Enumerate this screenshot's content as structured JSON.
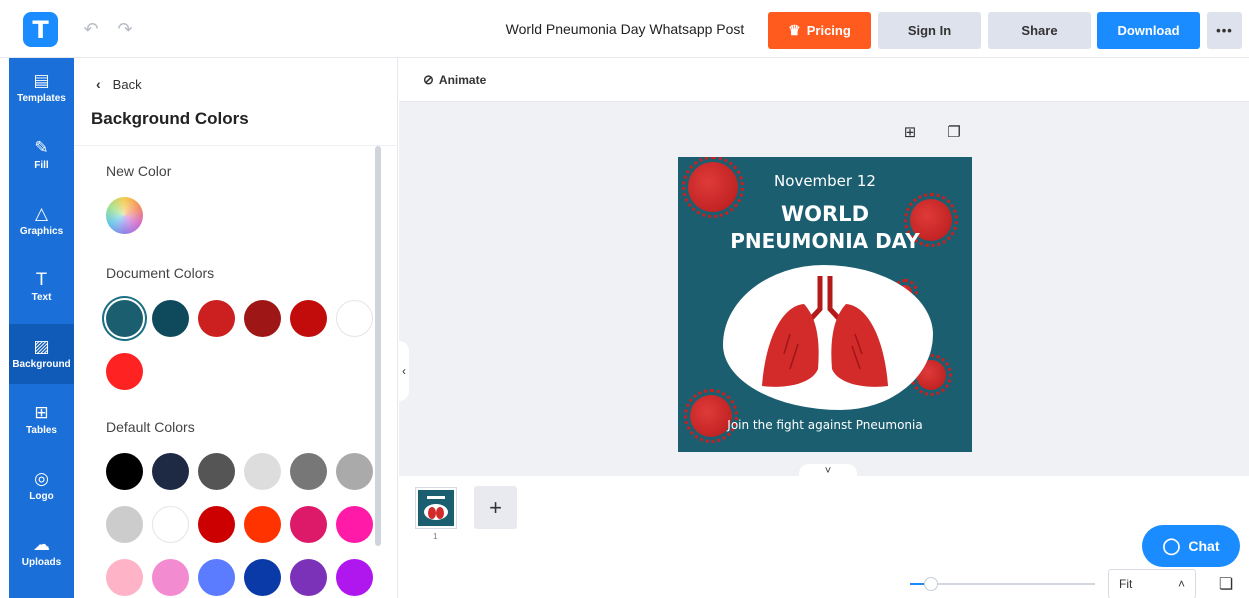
{
  "header": {
    "logo_letter": "T",
    "doc_title": "World Pneumonia Day Whatsapp Post",
    "pricing_label": "Pricing",
    "signin_label": "Sign In",
    "share_label": "Share",
    "download_label": "Download",
    "more_label": "•••"
  },
  "rail": {
    "items": [
      {
        "label": "Templates",
        "icon": "templates-icon"
      },
      {
        "label": "Fill",
        "icon": "pencil-icon"
      },
      {
        "label": "Graphics",
        "icon": "shapes-icon"
      },
      {
        "label": "Text",
        "icon": "text-icon"
      },
      {
        "label": "Background",
        "icon": "background-icon"
      },
      {
        "label": "Tables",
        "icon": "table-icon"
      },
      {
        "label": "Logo",
        "icon": "logo-icon"
      },
      {
        "label": "Uploads",
        "icon": "upload-cloud-icon"
      }
    ],
    "active": "Background"
  },
  "panel": {
    "back_label": "Back",
    "title": "Background Colors",
    "new_color_label": "New Color",
    "document_colors_label": "Document Colors",
    "default_colors_label": "Default Colors",
    "document_colors": [
      "#1b5e70",
      "#0f4a5c",
      "#cc1f1f",
      "#9e1616",
      "#c20c0c",
      "#ffffff",
      "#ff2222"
    ],
    "default_colors": [
      "#000000",
      "#1e2a44",
      "#555555",
      "#dddddd",
      "#777777",
      "#aaaaaa",
      "#cccccc",
      "#ffffff",
      "#cc0000",
      "#ff3300",
      "#dd1a6a",
      "#ff1aa8",
      "#ffb3c6",
      "#f38bd0",
      "#5b7cff",
      "#0a3aa8",
      "#7b32b8",
      "#b016ee"
    ],
    "selected_document_color": "#1b5e70"
  },
  "canvas": {
    "animate_label": "Animate",
    "design": {
      "date_text": "November 12",
      "title_line1": "WORLD",
      "title_line2": "PNEUMONIA DAY",
      "footer_text": "Join the fight against Pneumonia"
    },
    "thumb_page_number": "1",
    "chat_label": "Chat",
    "zoom_label": "Fit"
  }
}
